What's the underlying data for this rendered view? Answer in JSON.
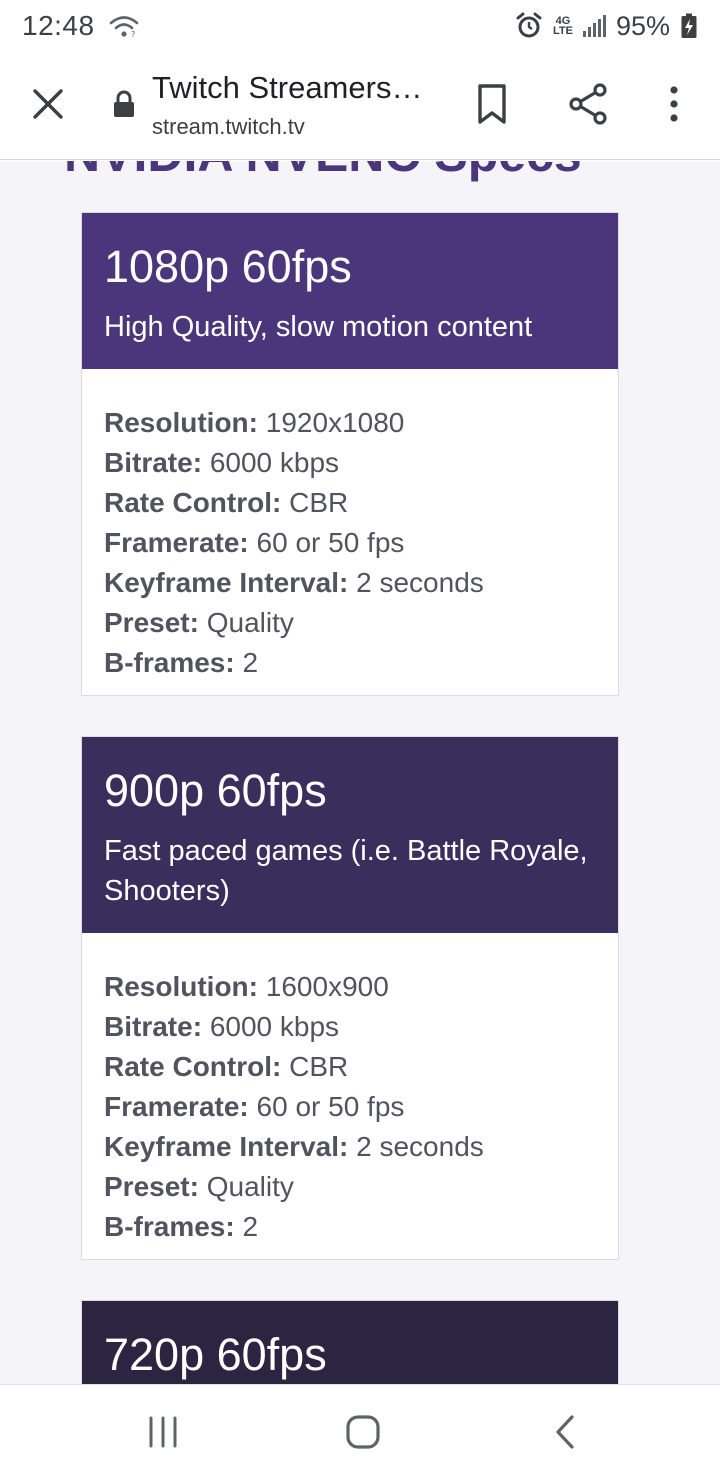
{
  "status_bar": {
    "time": "12:48",
    "network": "4G LTE",
    "battery": "95%"
  },
  "browser": {
    "title": "Twitch Streamers…",
    "url": "stream.twitch.tv"
  },
  "page": {
    "section_heading": "NVIDIA NVENC Specs",
    "cards": [
      {
        "header_color": "#4b367c",
        "title": "1080p 60fps",
        "subtitle": "High Quality, slow motion content",
        "specs": [
          {
            "key": "Resolution",
            "value": "1920x1080"
          },
          {
            "key": "Bitrate",
            "value": "6000 kbps"
          },
          {
            "key": "Rate Control",
            "value": "CBR"
          },
          {
            "key": "Framerate",
            "value": "60 or 50 fps"
          },
          {
            "key": "Keyframe Interval",
            "value": "2 seconds"
          },
          {
            "key": "Preset",
            "value": "Quality"
          },
          {
            "key": "B-frames",
            "value": "2"
          }
        ]
      },
      {
        "header_color": "#392e5c",
        "title": "900p 60fps",
        "subtitle": "Fast paced games (i.e. Battle Royale, Shooters)",
        "specs": [
          {
            "key": "Resolution",
            "value": "1600x900"
          },
          {
            "key": "Bitrate",
            "value": "6000 kbps"
          },
          {
            "key": "Rate Control",
            "value": "CBR"
          },
          {
            "key": "Framerate",
            "value": "60 or 50 fps"
          },
          {
            "key": "Keyframe Interval",
            "value": "2 seconds"
          },
          {
            "key": "Preset",
            "value": "Quality"
          },
          {
            "key": "B-frames",
            "value": "2"
          }
        ]
      },
      {
        "header_color": "#2c2541",
        "title": "720p 60fps"
      }
    ]
  }
}
